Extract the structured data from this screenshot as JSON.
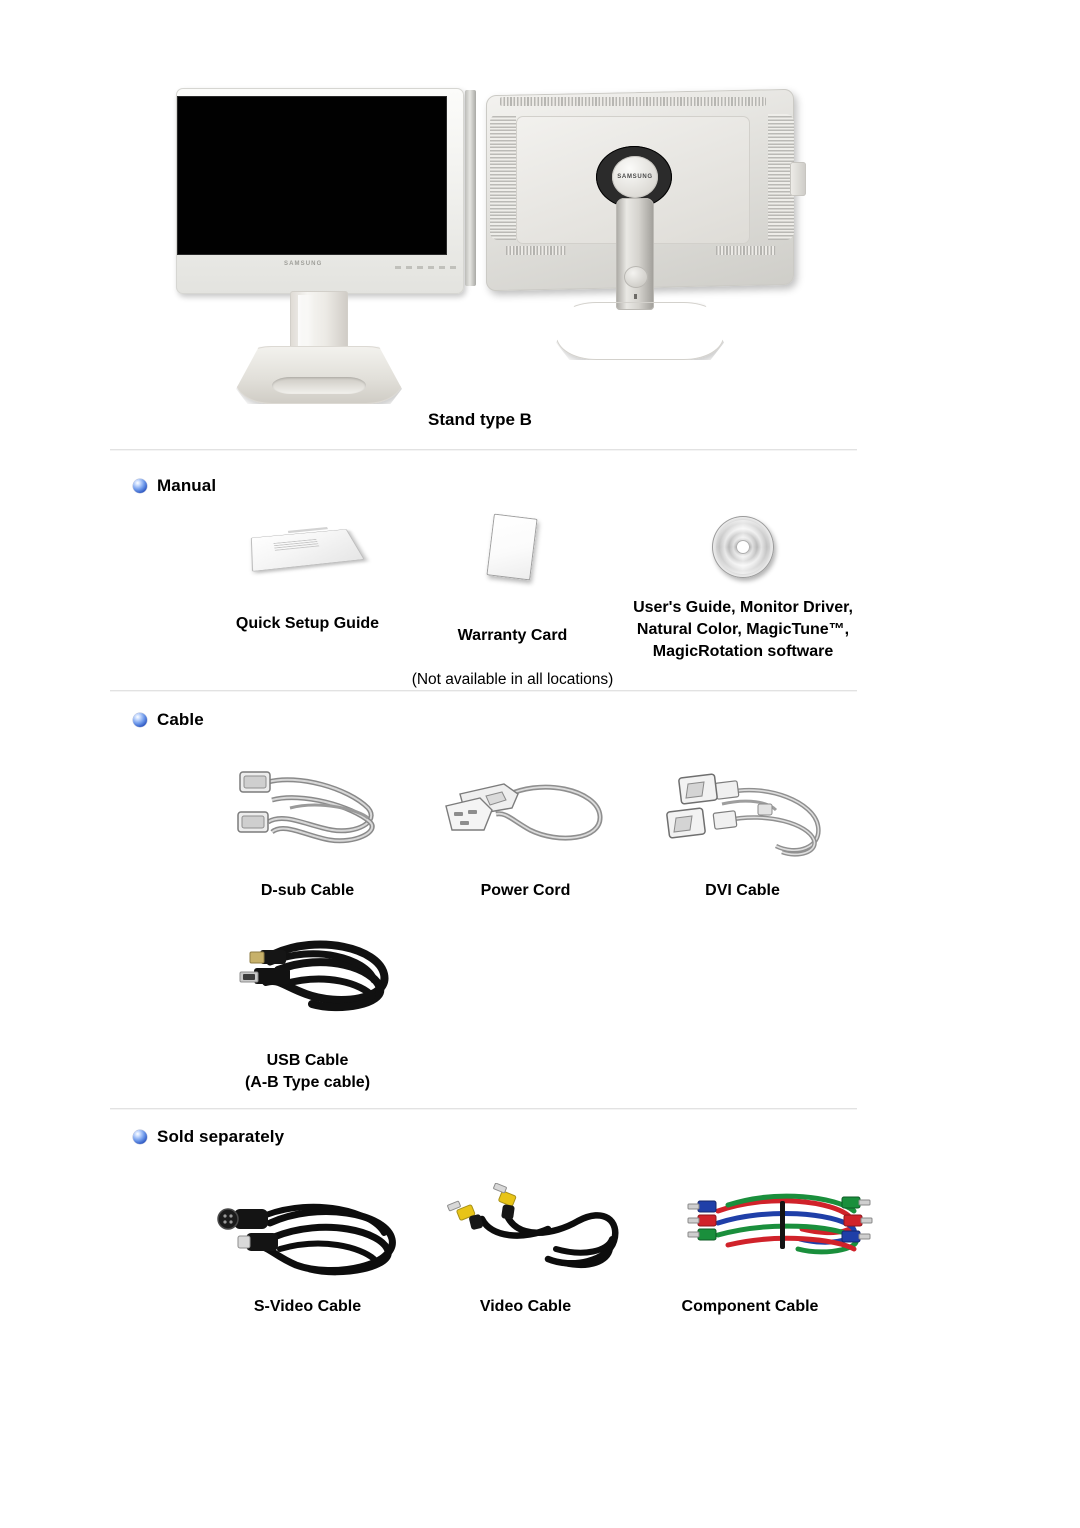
{
  "document": {
    "stand_caption": "Stand type B"
  },
  "sections": [
    {
      "id": "manual",
      "bullet_icon": "blue-sphere-bullet-icon",
      "title": "Manual",
      "items": [
        {
          "label": "Quick Setup Guide",
          "sublabel": "",
          "icon": "booklet-icon"
        },
        {
          "label": "Warranty Card",
          "sublabel": "(Not available in all locations)",
          "icon": "card-icon"
        },
        {
          "label": "User's Guide, Monitor Driver,\nNatural Color, MagicTune™,\nMagicRotation software",
          "sublabel": "",
          "icon": "cd-disc-icon"
        }
      ]
    },
    {
      "id": "cable",
      "bullet_icon": "blue-sphere-bullet-icon",
      "title": "Cable",
      "items": [
        {
          "label": "D-sub Cable",
          "sublabel": "",
          "icon": "dsub-cable-icon"
        },
        {
          "label": "Power Cord",
          "sublabel": "",
          "icon": "power-cord-icon"
        },
        {
          "label": "DVI Cable",
          "sublabel": "",
          "icon": "dvi-cable-icon"
        },
        {
          "label": "USB Cable\n(A-B Type cable)",
          "sublabel": "",
          "icon": "usb-cable-icon"
        }
      ]
    },
    {
      "id": "sold-separately",
      "bullet_icon": "blue-sphere-bullet-icon",
      "title": "Sold separately",
      "items": [
        {
          "label": "S-Video Cable",
          "sublabel": "",
          "icon": "svideo-cable-icon"
        },
        {
          "label": "Video Cable",
          "sublabel": "",
          "icon": "video-cable-icon"
        },
        {
          "label": "Component Cable",
          "sublabel": "",
          "icon": "component-cable-icon"
        }
      ]
    }
  ],
  "monitors": [
    {
      "view": "front",
      "brand": "SAMSUNG",
      "alt": "monitor-front-view"
    },
    {
      "view": "back",
      "brand": "SAMSUNG",
      "alt": "monitor-back-view"
    }
  ],
  "colors": {
    "bullet_blue": "#2b55c0",
    "divider": "#e2e2e2",
    "text": "#000000",
    "component_red": "#d0222a",
    "component_green": "#1a8f3c",
    "component_blue": "#1f3fa8",
    "video_yellow": "#e8c417"
  }
}
